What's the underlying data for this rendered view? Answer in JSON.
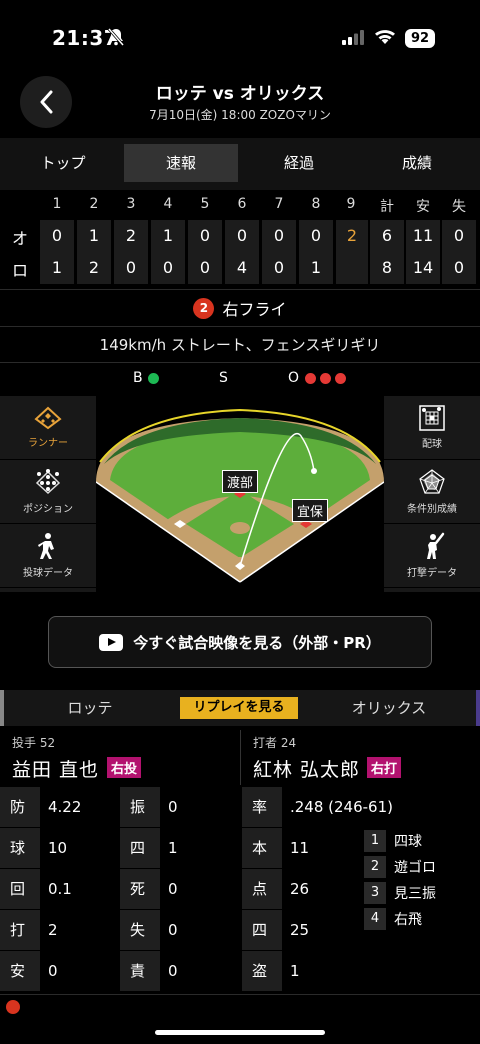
{
  "status_bar": {
    "time": "21:37",
    "battery": "92"
  },
  "header": {
    "title": "ロッテ vs オリックス",
    "subtitle": "7月10日(金) 18:00 ZOZOマリン"
  },
  "tabs": [
    "トップ",
    "速報",
    "経過",
    "成績"
  ],
  "active_tab": "速報",
  "scoreboard": {
    "columns": [
      "1",
      "2",
      "3",
      "4",
      "5",
      "6",
      "7",
      "8",
      "9",
      "計",
      "安",
      "失"
    ],
    "rows": [
      {
        "team": "オ",
        "cells": [
          "0",
          "1",
          "2",
          "1",
          "0",
          "0",
          "0",
          "0",
          "2",
          "6",
          "11",
          "0"
        ]
      },
      {
        "team": "ロ",
        "cells": [
          "1",
          "2",
          "0",
          "0",
          "0",
          "4",
          "0",
          "1",
          "",
          "8",
          "14",
          "0"
        ]
      }
    ]
  },
  "play": {
    "number": "2",
    "result": "右フライ",
    "detail": "149km/h ストレート、フェンスギリギリ"
  },
  "count": {
    "b_label": "B",
    "s_label": "S",
    "o_label": "O",
    "balls": 1,
    "strikes": 0,
    "outs": 3,
    "ball_color": "#1db954",
    "out_color": "#e53935"
  },
  "side_left": [
    {
      "label": "ランナー",
      "icon": "runner-diamond-icon"
    },
    {
      "label": "ポジション",
      "icon": "position-icon"
    },
    {
      "label": "投球データ",
      "icon": "pitcher-icon"
    }
  ],
  "side_right": [
    {
      "label": "配球",
      "icon": "pitch-grid-icon"
    },
    {
      "label": "条件別成績",
      "icon": "radar-chart-icon"
    },
    {
      "label": "打撃データ",
      "icon": "batter-icon"
    }
  ],
  "field": {
    "fielder_1": "渡部",
    "fielder_2": "宜保"
  },
  "video_button": "今すぐ試合映像を見る（外部・PR）",
  "team_tabs": {
    "home": "ロッテ",
    "replay": "リプレイを見る",
    "away": "オリックス"
  },
  "pitcher": {
    "role": "投手 52",
    "name": "益田 直也",
    "hand": "右投"
  },
  "batter": {
    "role": "打者 24",
    "name": "紅林 弘太郎",
    "hand": "右打"
  },
  "pitcher_stats": [
    {
      "l1": "防",
      "v1": "4.22",
      "l2": "振",
      "v2": "0"
    },
    {
      "l1": "球",
      "v1": "10",
      "l2": "四",
      "v2": "1"
    },
    {
      "l1": "回",
      "v1": "0.1",
      "l2": "死",
      "v2": "0"
    },
    {
      "l1": "打",
      "v1": "2",
      "l2": "失",
      "v2": "0"
    },
    {
      "l1": "安",
      "v1": "0",
      "l2": "責",
      "v2": "0"
    }
  ],
  "batter_stats": [
    {
      "l": "率",
      "v": ".248 (246-61)"
    },
    {
      "l": "本",
      "v": "11"
    },
    {
      "l": "点",
      "v": "26"
    },
    {
      "l": "四",
      "v": "25"
    },
    {
      "l": "盗",
      "v": "1"
    }
  ],
  "at_bat_history": [
    {
      "n": "1",
      "r": "四球"
    },
    {
      "n": "2",
      "r": "遊ゴロ"
    },
    {
      "n": "3",
      "r": "見三振"
    },
    {
      "n": "4",
      "r": "右飛"
    }
  ]
}
